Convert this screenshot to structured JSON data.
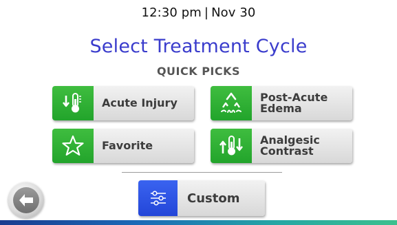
{
  "header": {
    "time": "12:30 pm",
    "separator": "|",
    "date": "Nov 30"
  },
  "title": "Select Treatment Cycle",
  "subtitle": "QUICK PICKS",
  "quick_picks": [
    {
      "label": "Acute Injury",
      "icon": "thermometer-down-icon"
    },
    {
      "label": "Post-Acute\nEdema",
      "icon": "recycle-edema-icon"
    },
    {
      "label": "Favorite",
      "icon": "star-icon"
    },
    {
      "label": "Analgesic\nContrast",
      "icon": "thermometer-updown-icon"
    }
  ],
  "custom": {
    "label": "Custom",
    "icon": "sliders-icon"
  },
  "back": {
    "icon": "arrow-left-icon"
  },
  "colors": {
    "title": "#3a3ccc",
    "pick_icon_bg": "#2aa934",
    "custom_icon_bg": "#2d52e2",
    "footer_gradient_start": "#1a3c8f",
    "footer_gradient_end": "#3cc08e"
  }
}
